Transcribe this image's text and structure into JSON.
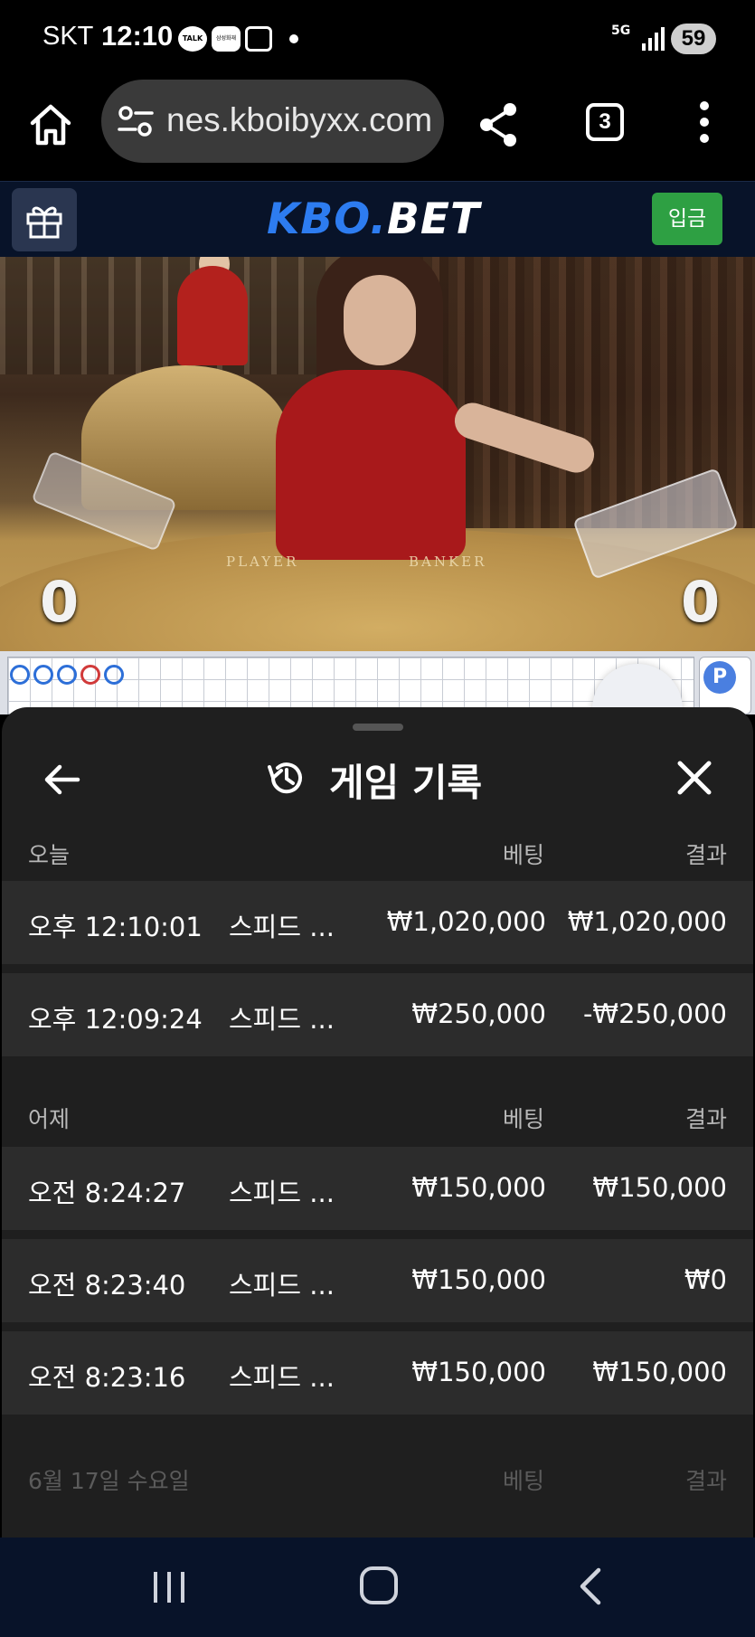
{
  "status_bar": {
    "carrier": "SKT",
    "time": "12:10",
    "network": "5G",
    "battery": "59",
    "talk_badge": "TALK",
    "bank_badge": "삼성화재"
  },
  "browser": {
    "url": "nes.kboibyxx.com",
    "tab_count": "3"
  },
  "site": {
    "brand_a": "KBO.",
    "brand_b": "BET",
    "deposit_label": "입금"
  },
  "live": {
    "player_label": "PLAYER",
    "banker_label": "BANKER",
    "player_score": "0",
    "banker_score": "0",
    "road_p": "P"
  },
  "history": {
    "title": "게임 기록",
    "sections": [
      {
        "day": "오늘",
        "bet_header": "베팅",
        "result_header": "결과",
        "rows": [
          {
            "time": "오후 12:10:01",
            "game": "스피드 ...",
            "bet": "₩1,020,000",
            "result": "₩1,020,000"
          },
          {
            "time": "오후 12:09:24",
            "game": "스피드 ...",
            "bet": "₩250,000",
            "result": "-₩250,000"
          }
        ]
      },
      {
        "day": "어제",
        "bet_header": "베팅",
        "result_header": "결과",
        "rows": [
          {
            "time": "오전 8:24:27",
            "game": "스피드 ...",
            "bet": "₩150,000",
            "result": "₩150,000"
          },
          {
            "time": "오전 8:23:40",
            "game": "스피드 ...",
            "bet": "₩150,000",
            "result": "₩0"
          },
          {
            "time": "오전 8:23:16",
            "game": "스피드 ...",
            "bet": "₩150,000",
            "result": "₩150,000"
          }
        ]
      },
      {
        "day": "6월 17일 수요일",
        "bet_header": "베팅",
        "result_header": "결과",
        "rows": []
      }
    ]
  },
  "colors": {
    "brand_blue": "#2d7cf0",
    "deposit_green": "#2ea043",
    "sheet_bg": "#1f1f1f",
    "row_bg": "#2c2c2c",
    "nav_bg": "#081329"
  }
}
